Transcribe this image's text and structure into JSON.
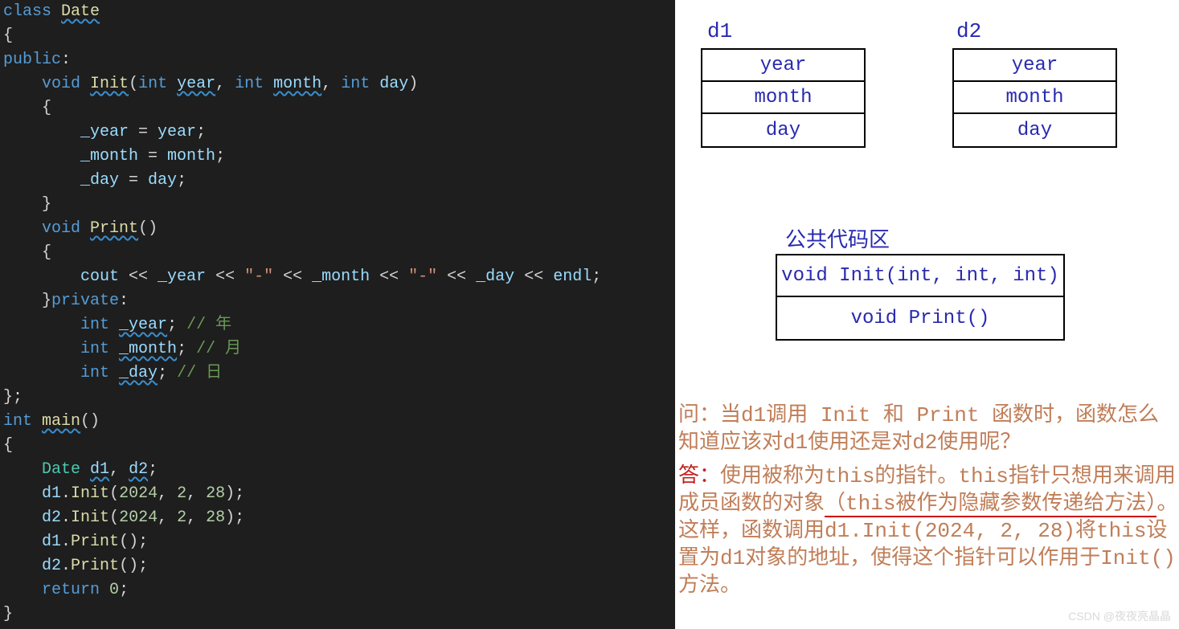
{
  "code_lines": [
    [
      [
        "kw",
        "class"
      ],
      [
        "p",
        " "
      ],
      [
        "id sq",
        "Date"
      ]
    ],
    [
      [
        "p",
        "{"
      ]
    ],
    [
      [
        "kw",
        "public"
      ],
      [
        "p",
        ":"
      ]
    ],
    [
      [
        "p",
        "    "
      ],
      [
        "kw",
        "void"
      ],
      [
        "p",
        " "
      ],
      [
        "id sq",
        "Init"
      ],
      [
        "p",
        "("
      ],
      [
        "kw",
        "int"
      ],
      [
        "p",
        " "
      ],
      [
        "lv sq",
        "year"
      ],
      [
        "p",
        ", "
      ],
      [
        "kw",
        "int"
      ],
      [
        "p",
        " "
      ],
      [
        "lv sq",
        "month"
      ],
      [
        "p",
        ", "
      ],
      [
        "kw",
        "int"
      ],
      [
        "p",
        " "
      ],
      [
        "lv",
        "day"
      ],
      [
        "p",
        ")"
      ]
    ],
    [
      [
        "p",
        "    {"
      ]
    ],
    [
      [
        "p",
        "        "
      ],
      [
        "lv",
        "_year"
      ],
      [
        "p",
        " = "
      ],
      [
        "lv",
        "year"
      ],
      [
        "p",
        ";"
      ]
    ],
    [
      [
        "p",
        "        "
      ],
      [
        "lv",
        "_month"
      ],
      [
        "p",
        " = "
      ],
      [
        "lv",
        "month"
      ],
      [
        "p",
        ";"
      ]
    ],
    [
      [
        "p",
        "        "
      ],
      [
        "lv",
        "_day"
      ],
      [
        "p",
        " = "
      ],
      [
        "lv",
        "day"
      ],
      [
        "p",
        ";"
      ]
    ],
    [
      [
        "p",
        "    }"
      ]
    ],
    [
      [
        "p",
        "    "
      ],
      [
        "kw",
        "void"
      ],
      [
        "p",
        " "
      ],
      [
        "id sq",
        "Print"
      ],
      [
        "p",
        "()"
      ]
    ],
    [
      [
        "p",
        "    {"
      ]
    ],
    [
      [
        "p",
        "        "
      ],
      [
        "lv",
        "cout"
      ],
      [
        "p",
        " << "
      ],
      [
        "lv",
        "_year"
      ],
      [
        "p",
        " << "
      ],
      [
        "str",
        "\"-\""
      ],
      [
        "p",
        " << "
      ],
      [
        "lv",
        "_month"
      ],
      [
        "p",
        " << "
      ],
      [
        "str",
        "\"-\""
      ],
      [
        "p",
        " << "
      ],
      [
        "lv",
        "_day"
      ],
      [
        "p",
        " << "
      ],
      [
        "lv",
        "endl"
      ],
      [
        "p",
        ";"
      ]
    ],
    [
      [
        "p",
        "    }"
      ],
      [
        "kw",
        "private"
      ],
      [
        "p",
        ":"
      ]
    ],
    [
      [
        "p",
        "        "
      ],
      [
        "kw",
        "int"
      ],
      [
        "p",
        " "
      ],
      [
        "lv sq",
        "_year"
      ],
      [
        "p",
        "; "
      ],
      [
        "cm",
        "// 年"
      ]
    ],
    [
      [
        "p",
        "        "
      ],
      [
        "kw",
        "int"
      ],
      [
        "p",
        " "
      ],
      [
        "lv sq",
        "_month"
      ],
      [
        "p",
        "; "
      ],
      [
        "cm",
        "// 月"
      ]
    ],
    [
      [
        "p",
        "        "
      ],
      [
        "kw",
        "int"
      ],
      [
        "p",
        " "
      ],
      [
        "lv sq",
        "_day"
      ],
      [
        "p",
        "; "
      ],
      [
        "cm",
        "// 日"
      ]
    ],
    [
      [
        "p",
        "};"
      ]
    ],
    [
      [
        "kw",
        "int"
      ],
      [
        "p",
        " "
      ],
      [
        "id sq",
        "main"
      ],
      [
        "p",
        "()"
      ]
    ],
    [
      [
        "p",
        "{"
      ]
    ],
    [
      [
        "p",
        "    "
      ],
      [
        "var",
        "Date"
      ],
      [
        "p",
        " "
      ],
      [
        "lv sq",
        "d1"
      ],
      [
        "p",
        ", "
      ],
      [
        "lv sq",
        "d2"
      ],
      [
        "p",
        ";"
      ]
    ],
    [
      [
        "p",
        "    "
      ],
      [
        "lv",
        "d1"
      ],
      [
        "p",
        "."
      ],
      [
        "id",
        "Init"
      ],
      [
        "p",
        "("
      ],
      [
        "num",
        "2024"
      ],
      [
        "p",
        ", "
      ],
      [
        "num",
        "2"
      ],
      [
        "p",
        ", "
      ],
      [
        "num",
        "28"
      ],
      [
        "p",
        ");"
      ]
    ],
    [
      [
        "p",
        "    "
      ],
      [
        "lv",
        "d2"
      ],
      [
        "p",
        "."
      ],
      [
        "id",
        "Init"
      ],
      [
        "p",
        "("
      ],
      [
        "num",
        "2024"
      ],
      [
        "p",
        ", "
      ],
      [
        "num",
        "2"
      ],
      [
        "p",
        ", "
      ],
      [
        "num",
        "28"
      ],
      [
        "p",
        ");"
      ]
    ],
    [
      [
        "p",
        "    "
      ],
      [
        "lv",
        "d1"
      ],
      [
        "p",
        "."
      ],
      [
        "id",
        "Print"
      ],
      [
        "p",
        "();"
      ]
    ],
    [
      [
        "p",
        "    "
      ],
      [
        "lv",
        "d2"
      ],
      [
        "p",
        "."
      ],
      [
        "id",
        "Print"
      ],
      [
        "p",
        "();"
      ]
    ],
    [
      [
        "p",
        "    "
      ],
      [
        "kw",
        "return"
      ],
      [
        "p",
        " "
      ],
      [
        "num",
        "0"
      ],
      [
        "p",
        ";"
      ]
    ],
    [
      [
        "p",
        "}"
      ]
    ]
  ],
  "diagram": {
    "d1": {
      "label": "d1",
      "cells": [
        "year",
        "month",
        "day"
      ]
    },
    "d2": {
      "label": "d2",
      "cells": [
        "year",
        "month",
        "day"
      ]
    },
    "shared": {
      "title": "公共代码区",
      "cells": [
        "void Init(int, int, int)",
        "void Print()"
      ]
    }
  },
  "explain": {
    "q_prefix": "问：",
    "q_text": "当d1调用 Init 和 Print 函数时，函数怎么知道应该对d1使用还是对d2使用呢？",
    "a_prefix": "答：",
    "a_text_1": "使用被称为this的指针。this指针只想用来调用成员函数的对象",
    "a_ul": "（this被作为隐藏参数传递给方法）",
    "a_text_2": "。这样，函数调用d1.Init(2024, 2, 28)将this设置为d1对象的地址，使得这个指针可以作用于Init()方法。"
  },
  "watermark": "CSDN @夜夜亮晶晶"
}
